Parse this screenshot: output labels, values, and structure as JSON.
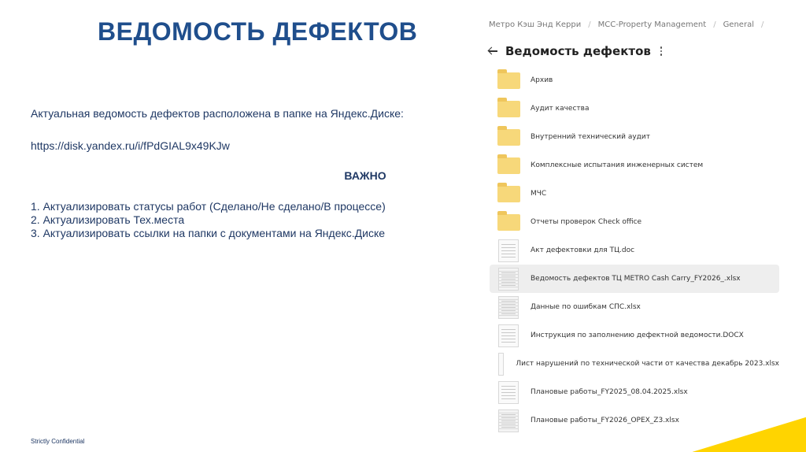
{
  "slide": {
    "title": "ВЕДОМОСТЬ ДЕФЕКТОВ",
    "intro": "Актуальная ведомость дефектов расположена в папке на Яндекс.Диске:",
    "url": "https://disk.yandex.ru/i/fPdGIAL9x49KJw",
    "important": "ВАЖНО",
    "steps": [
      "1. Актуализировать статусы работ (Сделано/Не сделано/В процессе)",
      "2. Актуализировать Тех.места",
      "3. Актуализировать ссылки на папки с документами на Яндекс.Диске"
    ],
    "footer": "Strictly Confidential"
  },
  "disk": {
    "breadcrumb": [
      "Метро Кэш Энд Керри",
      "MCC-Property Management",
      "General"
    ],
    "folder_title": "Ведомость дефектов",
    "items": [
      {
        "name": "Архив",
        "kind": "folder"
      },
      {
        "name": "Аудит качества",
        "kind": "folder"
      },
      {
        "name": "Внутренний технический аудит",
        "kind": "folder"
      },
      {
        "name": "Комплексные испытания инженерных систем",
        "kind": "folder"
      },
      {
        "name": "МЧС",
        "kind": "folder"
      },
      {
        "name": "Отчеты проверок Check office",
        "kind": "folder"
      },
      {
        "name": "Акт дефектовки для ТЦ.doc",
        "kind": "doc"
      },
      {
        "name": "Ведомость дефектов ТЦ METRO Cash Carry_FY2026_.xlsx",
        "kind": "xls",
        "selected": true
      },
      {
        "name": "Данные по ошибкам СПС.xlsx",
        "kind": "xls"
      },
      {
        "name": "Инструкция по заполнению дефектной ведомости.DOCX",
        "kind": "doc"
      },
      {
        "name": "Лист нарушений по технической части от качества декабрь 2023.xlsx",
        "kind": "color"
      },
      {
        "name": "Плановые работы_FY2025_08.04.2025.xlsx",
        "kind": "doc"
      },
      {
        "name": "Плановые работы_FY2026_OPEX_Z3.xlsx",
        "kind": "xls"
      }
    ]
  },
  "colors": {
    "title": "#1f4e8c",
    "accent": "#ffd400",
    "folder": "#f7d87a"
  }
}
